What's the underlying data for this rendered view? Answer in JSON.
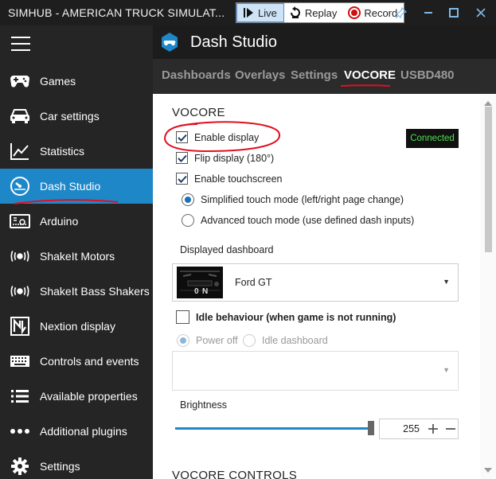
{
  "window": {
    "title": "SIMHUB - AMERICAN TRUCK SIMULAT...",
    "modes": [
      {
        "label": "Live",
        "icon": "play-icon",
        "active": true
      },
      {
        "label": "Replay",
        "icon": "replay-icon",
        "active": false
      },
      {
        "label": "Record",
        "icon": "record-icon",
        "active": false
      }
    ],
    "controls": [
      "pin-icon",
      "minimize-icon",
      "maximize-icon",
      "close-icon"
    ]
  },
  "sidebar": {
    "items": [
      {
        "label": "Games",
        "icon": "gamepad-icon",
        "active": false
      },
      {
        "label": "Car settings",
        "icon": "car-icon",
        "active": false
      },
      {
        "label": "Statistics",
        "icon": "chart-line-icon",
        "active": false
      },
      {
        "label": "Dash Studio",
        "icon": "gauge-icon",
        "active": true
      },
      {
        "label": "Arduino",
        "icon": "arduino-board-icon",
        "active": false
      },
      {
        "label": "ShakeIt Motors",
        "icon": "vibration-icon",
        "active": false
      },
      {
        "label": "ShakeIt Bass Shakers",
        "icon": "vibration-icon",
        "active": false
      },
      {
        "label": "Nextion display",
        "icon": "nextion-icon",
        "active": false
      },
      {
        "label": "Controls and events",
        "icon": "keyboard-icon",
        "active": false
      },
      {
        "label": "Available properties",
        "icon": "list-icon",
        "active": false
      },
      {
        "label": "Additional plugins",
        "icon": "more-dots-icon",
        "active": false
      },
      {
        "label": "Settings",
        "icon": "gear-icon",
        "active": false
      }
    ]
  },
  "header": {
    "title": "Dash Studio",
    "icon": "gamepad-logo-icon",
    "tabs": [
      {
        "label": "Dashboards",
        "active": false
      },
      {
        "label": "Overlays",
        "active": false
      },
      {
        "label": "Settings",
        "active": false
      },
      {
        "label": "VOCORE",
        "active": true
      },
      {
        "label": "USBD480",
        "active": false
      }
    ]
  },
  "vocore": {
    "section_title": "VOCORE",
    "status": "Connected",
    "enable_display": {
      "label": "Enable display",
      "checked": true
    },
    "flip_display": {
      "label": "Flip display (180°)",
      "checked": true
    },
    "enable_touchscreen": {
      "label": "Enable touchscreen",
      "checked": true
    },
    "touch_modes": [
      {
        "label": "Simplified touch mode (left/right page change)",
        "selected": true
      },
      {
        "label": "Advanced touch mode (use defined dash inputs)",
        "selected": false
      }
    ],
    "displayed_dashboard_label": "Displayed dashboard",
    "displayed_dashboard_value": "Ford GT",
    "thumbnail_text": [
      "0",
      "N"
    ],
    "idle_behaviour": {
      "label": "Idle behaviour (when game is not running)",
      "checked": false
    },
    "idle_options": [
      {
        "label": "Power off",
        "selected": true
      },
      {
        "label": "Idle dashboard",
        "selected": false
      }
    ],
    "idle_dashboard_value": "",
    "brightness_label": "Brightness",
    "brightness_value": "255",
    "brightness_level": 1.0,
    "next_section_title": "VOCORE CONTROLS"
  },
  "colors": {
    "accent": "#1e87c8",
    "sidebar_bg": "#252525",
    "status_text": "#4ee04e",
    "annotation": "#e01020"
  }
}
